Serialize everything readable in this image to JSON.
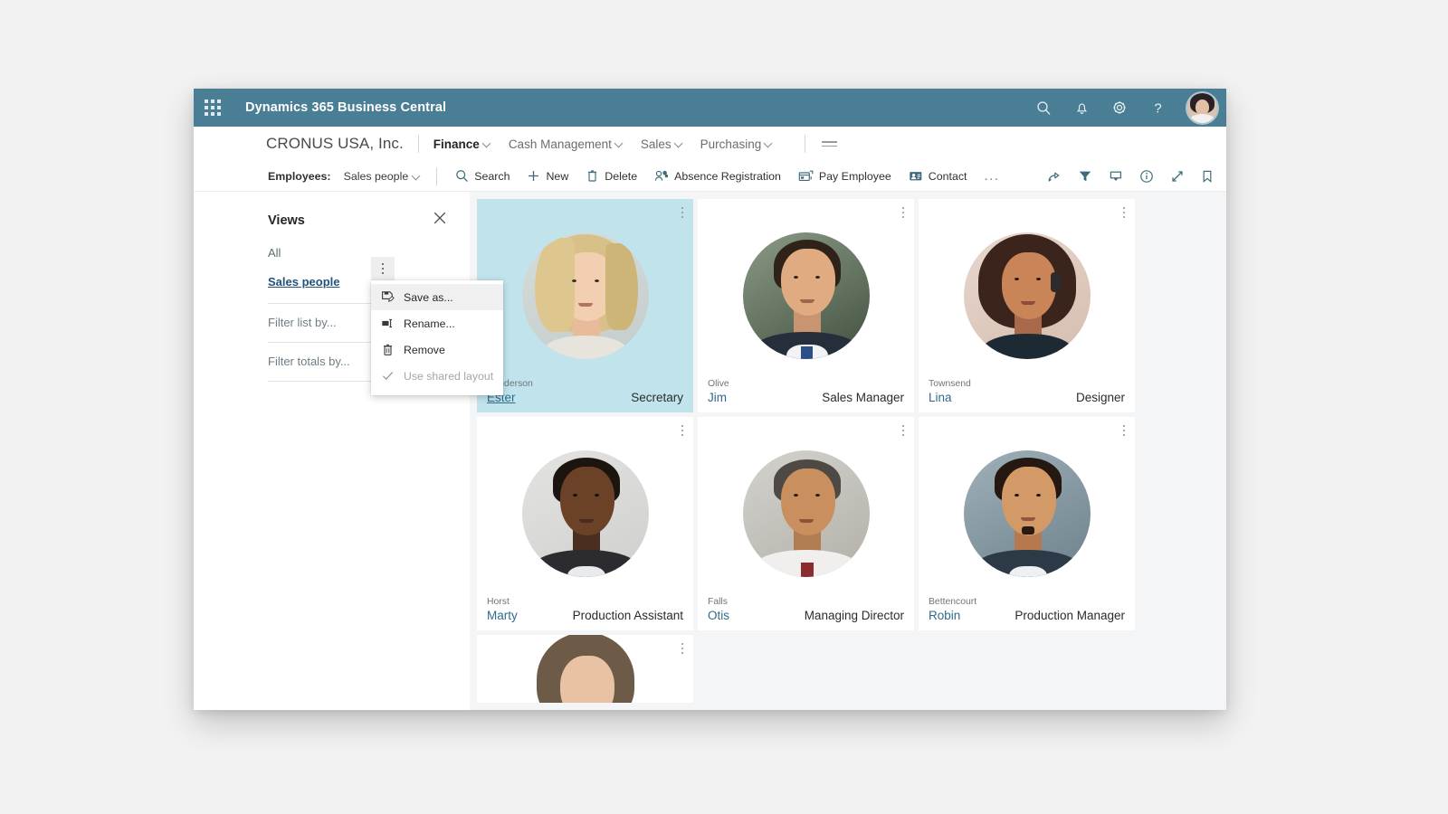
{
  "brand": {
    "title": "Dynamics 365 Business Central",
    "waffle_icon": "app-launcher-icon",
    "icons": [
      "search-icon",
      "notification-bell-icon",
      "settings-gear-icon",
      "help-question-icon"
    ],
    "avatar_label": "user-avatar",
    "bar_color": "#4a7e94"
  },
  "nav": {
    "company": "CRONUS USA, Inc.",
    "items": [
      {
        "label": "Finance",
        "active": true
      },
      {
        "label": "Cash Management",
        "active": false
      },
      {
        "label": "Sales",
        "active": false
      },
      {
        "label": "Purchasing",
        "active": false
      }
    ],
    "hamburger_icon": "menu-hamburger-icon"
  },
  "toolbar": {
    "entity_label": "Employees:",
    "view_selector": "Sales people",
    "actions": [
      {
        "label": "Search",
        "icon": "search-icon"
      },
      {
        "label": "New",
        "icon": "plus-icon"
      },
      {
        "label": "Delete",
        "icon": "trash-icon"
      },
      {
        "label": "Absence Registration",
        "icon": "absence-icon"
      },
      {
        "label": "Pay Employee",
        "icon": "pay-employee-icon"
      },
      {
        "label": "Contact",
        "icon": "contact-card-icon"
      }
    ],
    "overflow_label": "...",
    "right_icons": [
      "share-icon",
      "filter-funnel-icon",
      "focus-pin-icon",
      "info-circle-icon",
      "expand-arrows-icon",
      "bookmark-icon"
    ]
  },
  "views": {
    "title": "Views",
    "close_icon": "close-x-icon",
    "items": [
      {
        "label": "All",
        "selected": false
      },
      {
        "label": "Sales people",
        "selected": true
      }
    ],
    "dots_icon": "more-vertical-icon",
    "filters": [
      {
        "label": "Filter list by..."
      },
      {
        "label": "Filter totals by..."
      }
    ]
  },
  "context_menu": {
    "items": [
      {
        "label": "Save as...",
        "icon": "save-as-icon",
        "hovered": true,
        "disabled": false
      },
      {
        "label": "Rename...",
        "icon": "rename-icon",
        "hovered": false,
        "disabled": false
      },
      {
        "label": "Remove",
        "icon": "trash-icon",
        "hovered": false,
        "disabled": false
      },
      {
        "label": "Use shared layout",
        "icon": "checkmark-icon",
        "hovered": false,
        "disabled": true
      }
    ]
  },
  "employees": [
    {
      "last": "Henderson",
      "first": "Ester",
      "title": "Secretary",
      "selected": true
    },
    {
      "last": "Olive",
      "first": "Jim",
      "title": "Sales Manager",
      "selected": false
    },
    {
      "last": "Townsend",
      "first": "Lina",
      "title": "Designer",
      "selected": false
    },
    {
      "last": "Horst",
      "first": "Marty",
      "title": "Production Assistant",
      "selected": false
    },
    {
      "last": "Falls",
      "first": "Otis",
      "title": "Managing Director",
      "selected": false
    },
    {
      "last": "Bettencourt",
      "first": "Robin",
      "title": "Production Manager",
      "selected": false
    }
  ],
  "colors": {
    "selected_card": "#c1e4ec",
    "accent_link": "#2f6b8a",
    "page_background": "#f4f5f6"
  }
}
